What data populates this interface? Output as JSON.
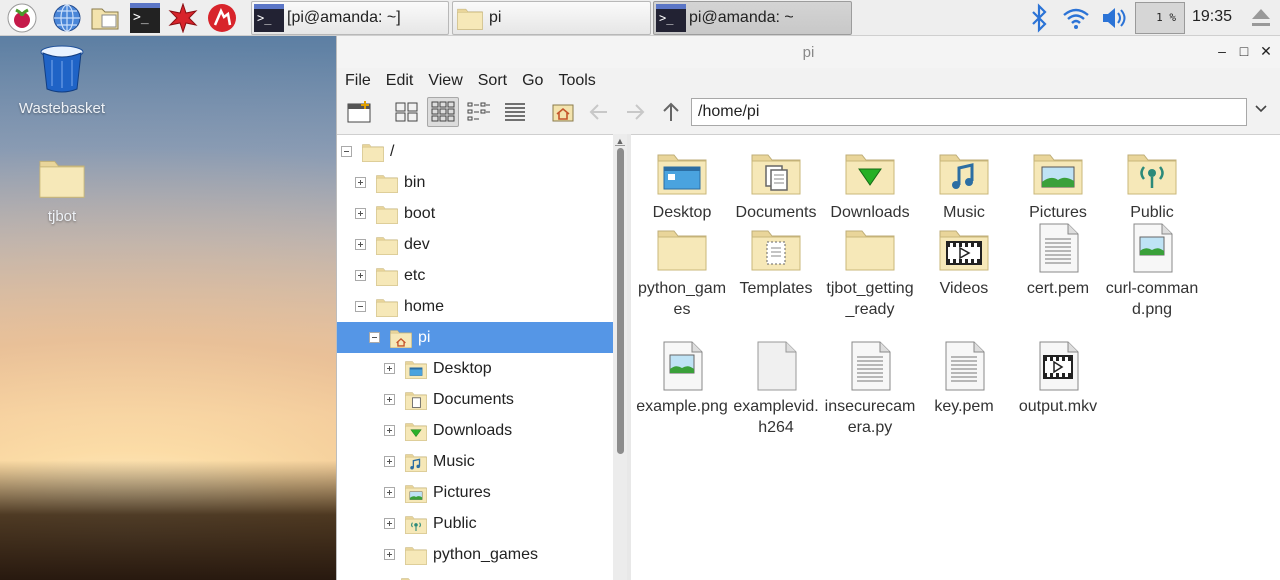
{
  "taskbar": {
    "tasks": [
      {
        "label": "[pi@amanda: ~]"
      },
      {
        "label": "pi"
      },
      {
        "label": "pi@amanda: ~"
      }
    ],
    "cpu": "1 %",
    "clock": "19:35"
  },
  "desktop": {
    "icons": [
      {
        "label": "Wastebasket"
      },
      {
        "label": "tjbot"
      }
    ]
  },
  "window": {
    "title": "pi",
    "menu": [
      "File",
      "Edit",
      "View",
      "Sort",
      "Go",
      "Tools"
    ],
    "path": "/home/pi"
  },
  "tree": [
    {
      "label": "/"
    },
    {
      "label": "bin"
    },
    {
      "label": "boot"
    },
    {
      "label": "dev"
    },
    {
      "label": "etc"
    },
    {
      "label": "home"
    },
    {
      "label": "pi"
    },
    {
      "label": "Desktop"
    },
    {
      "label": "Documents"
    },
    {
      "label": "Downloads"
    },
    {
      "label": "Music"
    },
    {
      "label": "Pictures"
    },
    {
      "label": "Public"
    },
    {
      "label": "python_games"
    }
  ],
  "files": [
    {
      "name": "Desktop"
    },
    {
      "name": "Documents"
    },
    {
      "name": "Downloads"
    },
    {
      "name": "Music"
    },
    {
      "name": "Pictures"
    },
    {
      "name": "Public"
    },
    {
      "name": "python_games"
    },
    {
      "name": "Templates"
    },
    {
      "name": "tjbot_getting_ready"
    },
    {
      "name": "Videos"
    },
    {
      "name": "cert.pem"
    },
    {
      "name": "curl-command.png"
    },
    {
      "name": "example.png"
    },
    {
      "name": "examplevid.h264"
    },
    {
      "name": "insecurecamera.py"
    },
    {
      "name": "key.pem"
    },
    {
      "name": "output.mkv"
    }
  ],
  "colors": {
    "selection": "#5596e6",
    "folder": "#f3e3ad",
    "folder_edge": "#c9b77a"
  }
}
